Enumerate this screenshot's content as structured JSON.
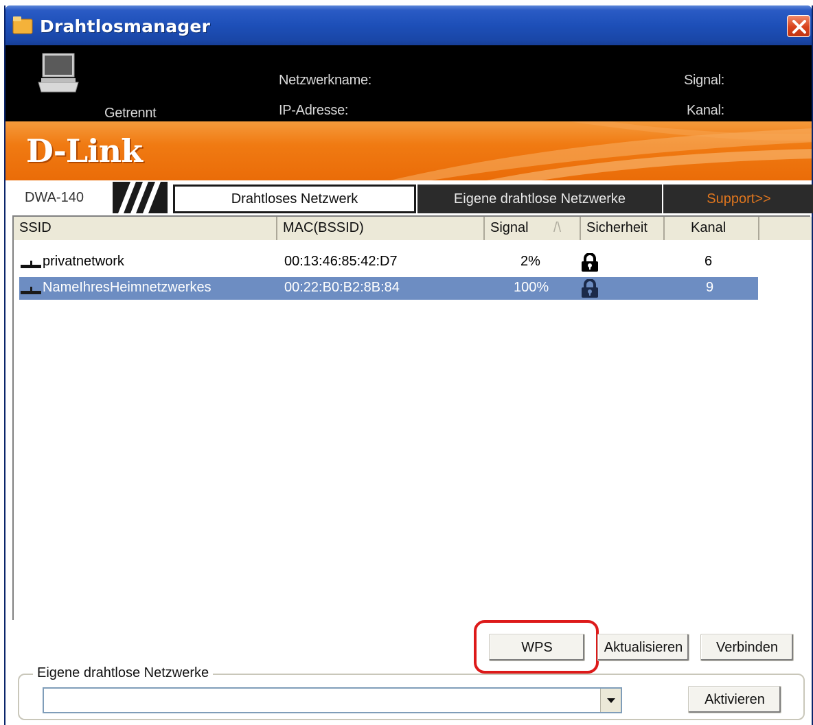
{
  "window": {
    "title": "Drahtlosmanager"
  },
  "status": {
    "connection_state": "Getrennt",
    "network_name_label": "Netzwerkname:",
    "ip_label": "IP-Adresse:",
    "signal_label": "Signal:",
    "channel_label": "Kanal:"
  },
  "brand": {
    "logo": "D-Link"
  },
  "tabs": {
    "model": "DWA-140",
    "items": [
      {
        "label": "Drahtloses Netzwerk",
        "active": true
      },
      {
        "label": "Eigene drahtlose Netzwerke",
        "active": false
      },
      {
        "label": "Support>>",
        "active": false
      }
    ]
  },
  "table": {
    "columns": [
      "SSID",
      "MAC(BSSID)",
      "Signal",
      "Sicherheit",
      "Kanal"
    ],
    "sort_indicator": "/\\",
    "rows": [
      {
        "ssid": "privatnetwork",
        "mac": "00:13:46:85:42:D7",
        "signal": "2%",
        "secured": true,
        "channel": "6",
        "selected": false
      },
      {
        "ssid": "NameIhresHeimnetzwerkes",
        "mac": "00:22:B0:B2:8B:84",
        "signal": "100%",
        "secured": true,
        "channel": "9",
        "selected": true
      }
    ]
  },
  "buttons": {
    "wps": "WPS",
    "refresh": "Aktualisieren",
    "connect": "Verbinden",
    "activate": "Aktivieren"
  },
  "profiles": {
    "group_label": "Eigene drahtlose Netzwerke",
    "selected_value": ""
  },
  "colors": {
    "titlebar": "#1d4fb8",
    "brand_orange": "#f07a12",
    "selection": "#6d8dc2",
    "highlight_ring": "#dd1a1a",
    "support_text": "#e0761e"
  }
}
